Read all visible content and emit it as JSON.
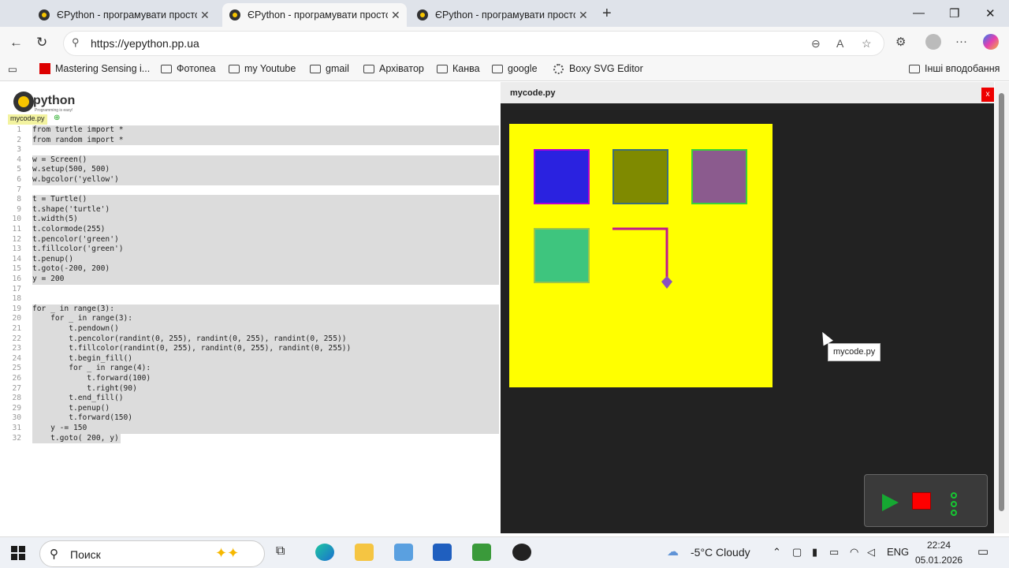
{
  "browser": {
    "tabs": [
      {
        "title": "ЄPython - програмувати просто!"
      },
      {
        "title": "ЄPython - програмувати просто!"
      },
      {
        "title": "ЄPython - програмувати просто!"
      }
    ],
    "url": "https://yepython.pp.ua",
    "bookmarks": [
      "Mastering Sensing i...",
      "Фотопеа",
      "my Youtube",
      "gmail",
      "Архіватор",
      "Канва",
      "google",
      "Boxy SVG Editor"
    ],
    "other_bookmarks": "Інші вподобання"
  },
  "editor": {
    "logo_text": "python",
    "logo_sub": "Programming is easy!",
    "file_tab": "mycode.py",
    "lines": [
      "from turtle import *",
      "from random import *",
      "",
      "w = Screen()",
      "w.setup(500, 500)",
      "w.bgcolor('yellow')",
      "",
      "t = Turtle()",
      "t.shape('turtle')",
      "t.width(5)",
      "t.colormode(255)",
      "t.pencolor('green')",
      "t.fillcolor('green')",
      "t.penup()",
      "t.goto(-200, 200)",
      "y = 200",
      "",
      "",
      "for _ in range(3):",
      "    for _ in range(3):",
      "        t.pendown()",
      "        t.pencolor(randint(0, 255), randint(0, 255), randint(0, 255))",
      "        t.fillcolor(randint(0, 255), randint(0, 255), randint(0, 255))",
      "        t.begin_fill()",
      "        for _ in range(4):",
      "            t.forward(100)",
      "            t.right(90)",
      "        t.end_fill()",
      "        t.penup()",
      "        t.forward(150)",
      "    y -= 150",
      "    t.goto( 200, y)"
    ]
  },
  "output": {
    "title": "mycode.py",
    "close": "x",
    "tooltip": "mycode.py",
    "canvas_bg": "#ffff00",
    "squares": [
      {
        "fill": "#2a22e0",
        "border": "#b000d8"
      },
      {
        "fill": "#7f8a00",
        "border": "#3b6e7a"
      },
      {
        "fill": "#8b5b8e",
        "border": "#3ad038"
      },
      {
        "fill": "#3ec57e",
        "border": "#9ac44a"
      }
    ],
    "pen_color": "#c0188e"
  },
  "taskbar": {
    "search": "Поиск",
    "weather": "-5°C Cloudy",
    "lang": "ENG",
    "time": "22:24",
    "date": "05.01.2026"
  }
}
